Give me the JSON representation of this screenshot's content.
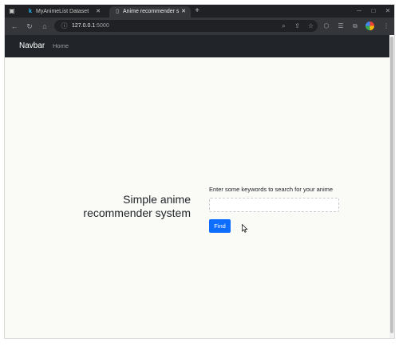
{
  "browser": {
    "tabs": [
      {
        "title": "MyAnimeList Dataset",
        "favicon": "kaggle-icon",
        "active": false
      },
      {
        "title": "Anime recommender sy",
        "favicon": "document-icon",
        "active": true
      }
    ],
    "new_tab_symbol": "+",
    "address": {
      "host": "127.0.0.1",
      "port": ":5000"
    }
  },
  "page": {
    "navbar": {
      "brand": "Navbar",
      "links": [
        {
          "label": "Home"
        }
      ]
    },
    "hero_title": "Simple anime recommender system",
    "search": {
      "label": "Enter some keywords to search for your anime",
      "value": "",
      "placeholder": "",
      "button_label": "Find"
    }
  },
  "colors": {
    "navbar_bg": "#212529",
    "button_bg": "#0d6efd",
    "page_bg": "#fafaf7",
    "chrome_bg": "#202124"
  }
}
